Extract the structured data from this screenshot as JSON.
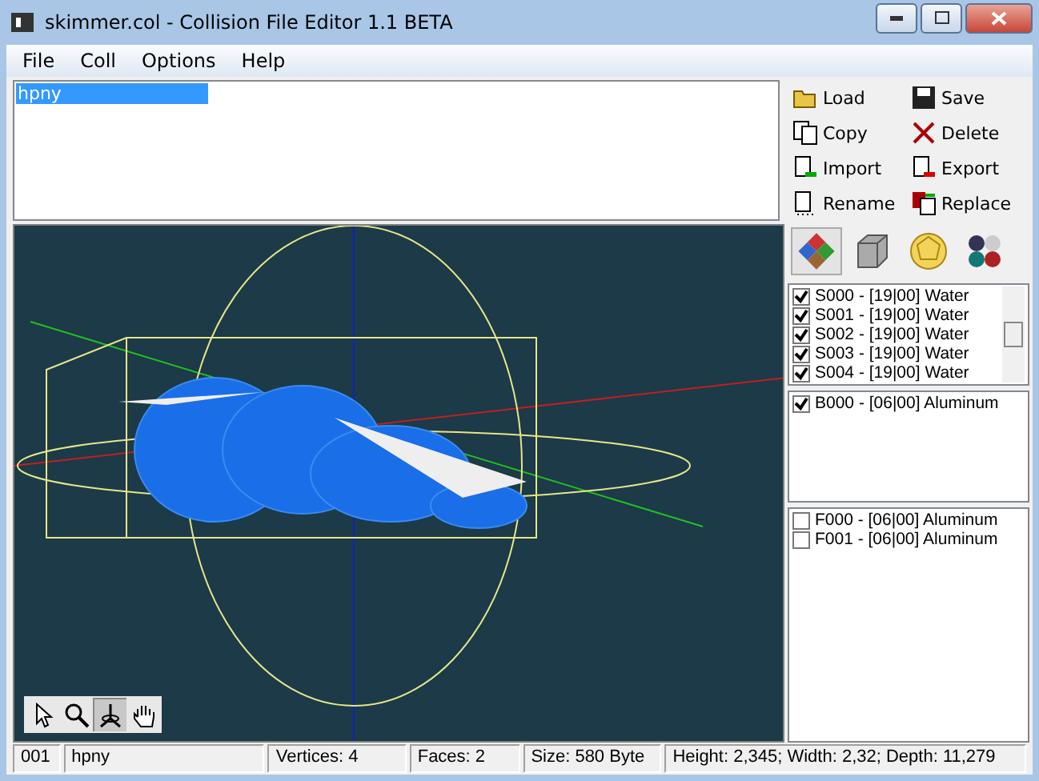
{
  "window": {
    "title": "skimmer.col - Collision File Editor 1.1 BETA"
  },
  "menu": [
    "File",
    "Coll",
    "Options",
    "Help"
  ],
  "models": [
    {
      "name": "hpny",
      "selected": true
    }
  ],
  "actions": [
    "Load",
    "Save",
    "Copy",
    "Delete",
    "Import",
    "Export",
    "Rename",
    "Replace"
  ],
  "view_modes": [
    {
      "kind": "faces",
      "selected": true
    },
    {
      "kind": "box",
      "selected": false
    },
    {
      "kind": "sphere",
      "selected": false
    },
    {
      "kind": "materials",
      "selected": false
    }
  ],
  "spheres": [
    {
      "label": "S000 - [19|00] Water",
      "checked": true
    },
    {
      "label": "S001 - [19|00] Water",
      "checked": true
    },
    {
      "label": "S002 - [19|00] Water",
      "checked": true
    },
    {
      "label": "S003 - [19|00] Water",
      "checked": true
    },
    {
      "label": "S004 - [19|00] Water",
      "checked": true
    }
  ],
  "boxes": [
    {
      "label": "B000 - [06|00] Aluminum",
      "checked": true
    }
  ],
  "faces": [
    {
      "label": "F000 - [06|00] Aluminum",
      "checked": false
    },
    {
      "label": "F001 - [06|00] Aluminum",
      "checked": false
    }
  ],
  "viewport_tools": [
    {
      "kind": "pointer",
      "selected": false
    },
    {
      "kind": "zoom",
      "selected": false
    },
    {
      "kind": "rotate",
      "selected": true
    },
    {
      "kind": "pan",
      "selected": false
    }
  ],
  "status_bar": [
    "001",
    "hpny",
    "Vertices: 4",
    "Faces: 2",
    "Size: 580 Byte",
    "Height: 2,345; Width: 2,32; Depth: 11,279"
  ]
}
